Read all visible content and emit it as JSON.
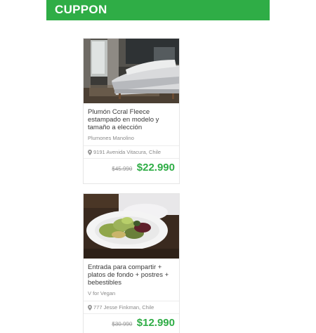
{
  "header": {
    "brand": "CUPPON",
    "color": "#2fad46"
  },
  "deals": [
    {
      "title": "Plumón Ccral Fleece estampado en modelo y tamaño a elección",
      "merchant": "Plumones Manolino",
      "location": "9191 Avenida Vitacura, Chile",
      "old_price": "$45.990",
      "new_price": "$22.990",
      "image": "bedroom-photo"
    },
    {
      "title": "Entrada para compartir + platos de fondo + postres + bebestibles",
      "merchant": "V for Vegan",
      "location": "777 Jesse Finkman, Chile",
      "old_price": "$30.990",
      "new_price": "$12.990",
      "image": "salad-photo"
    }
  ],
  "icons": {
    "location": "map-pin-icon"
  }
}
